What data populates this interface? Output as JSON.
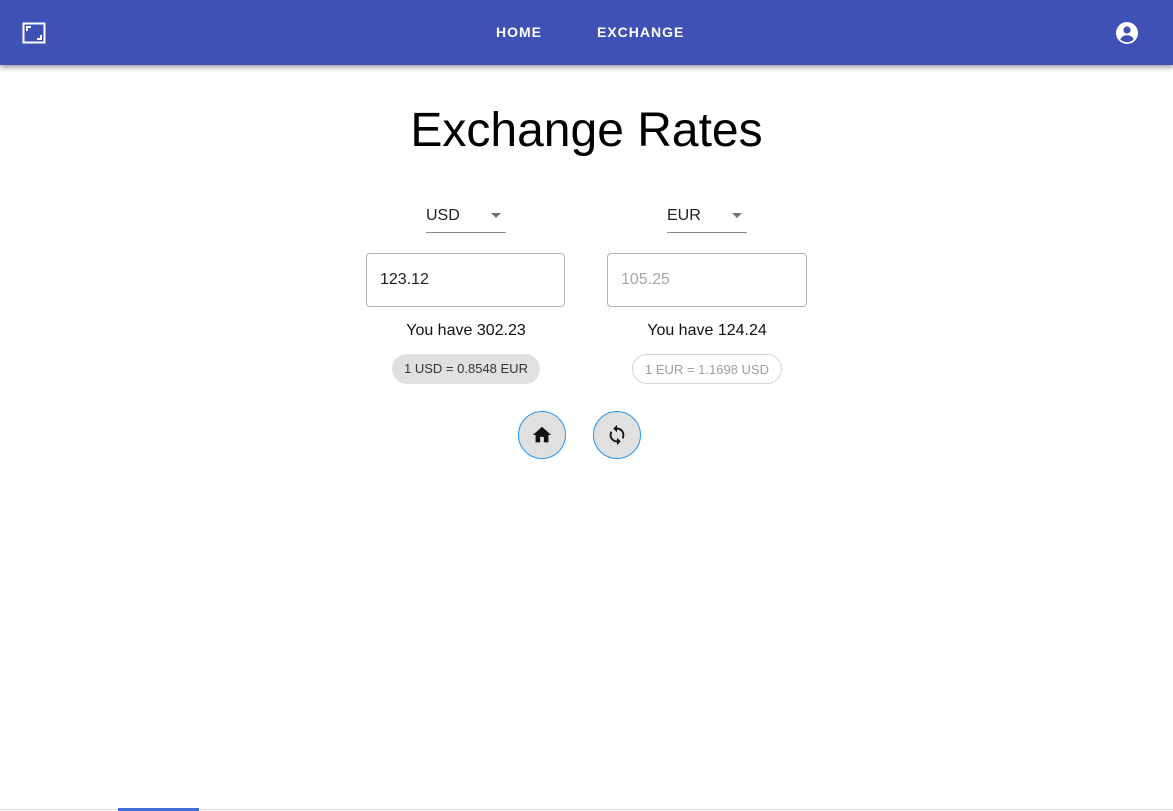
{
  "appbar": {
    "nav": [
      {
        "label": "HOME"
      },
      {
        "label": "EXCHANGE"
      }
    ],
    "icons": {
      "app": "aspect-ratio-icon",
      "account": "account-circle-icon"
    },
    "color": "#3f51b5"
  },
  "page": {
    "title": "Exchange Rates"
  },
  "from": {
    "currency": "USD",
    "amount": "123.12",
    "balance": "You have 302.23",
    "rate": "1 USD = 0.8548 EUR"
  },
  "to": {
    "currency": "EUR",
    "amount_placeholder": "105.25",
    "balance": "You have 124.24",
    "rate": "1 EUR = 1.1698 USD"
  },
  "actions": {
    "home_icon": "home-icon",
    "swap_icon": "refresh-swap-icon"
  },
  "accent_color": "#2196f3"
}
